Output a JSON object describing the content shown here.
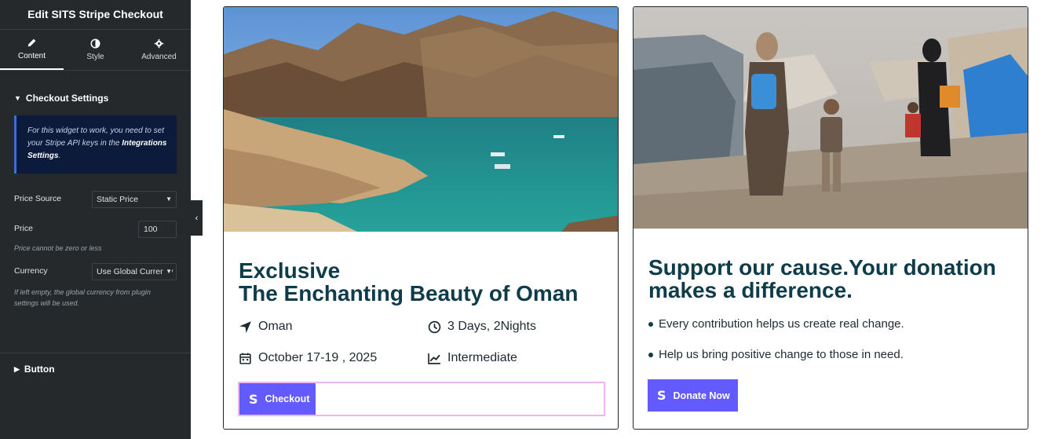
{
  "sidebar": {
    "title": "Edit SITS Stripe Checkout",
    "tabs": [
      {
        "label": "Content",
        "icon": "pencil-icon"
      },
      {
        "label": "Style",
        "icon": "half-circle-icon"
      },
      {
        "label": "Advanced",
        "icon": "gear-icon"
      }
    ],
    "section": "Checkout Settings",
    "notice": {
      "text": "For this widget to work, you need to set your Stripe API keys in the",
      "link": "Integrations Settings",
      "suffix": "."
    },
    "price_source": {
      "label": "Price Source",
      "value": "Static Price"
    },
    "price": {
      "label": "Price",
      "value": "100",
      "help": "Price cannot be zero or less"
    },
    "currency": {
      "label": "Currency",
      "value": "Use Global Currency",
      "help": "If left empty, the global currency from plugin settings will be used."
    },
    "button_section": "Button"
  },
  "card1": {
    "title_line1": "Exclusive",
    "title_line2": "The Enchanting Beauty of Oman",
    "location": "Oman",
    "duration": "3 Days, 2Nights",
    "dates": "October 17-19 , 2025",
    "level": "Intermediate",
    "button_icon": "S",
    "button_label": "Checkout"
  },
  "card2": {
    "title_line1": "Support our cause.Your donation",
    "title_line2": "makes a difference.",
    "bullets": [
      "Every contribution helps us create real change.",
      "Help us bring positive change to those in need."
    ],
    "button_icon": "S",
    "button_label": "Donate Now"
  },
  "colors": {
    "sidebar_bg": "#26292c",
    "title_color": "#0f3c4a",
    "stripe_purple": "#635bff",
    "checkout_border": "#f2b6f2"
  }
}
